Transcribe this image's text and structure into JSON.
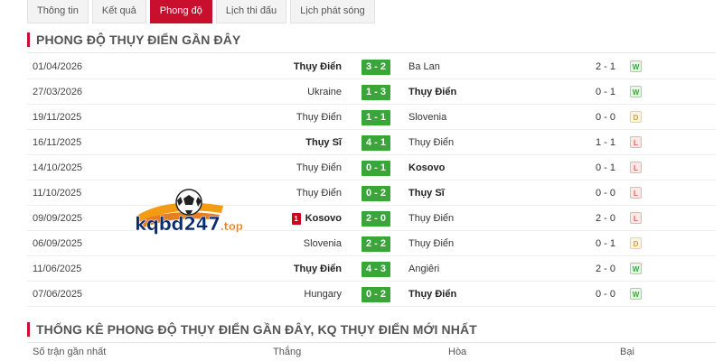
{
  "tabs": [
    {
      "label": "Thông tin",
      "active": false
    },
    {
      "label": "Kết quả",
      "active": false
    },
    {
      "label": "Phong độ",
      "active": true
    },
    {
      "label": "Lịch thi đấu",
      "active": false
    },
    {
      "label": "Lịch phát sóng",
      "active": false
    }
  ],
  "section1": {
    "title": "PHONG ĐỘ THỤY ĐIỂN GẦN ĐÂY"
  },
  "matches": [
    {
      "date": "01/04/2026",
      "home": "Thụy Điển",
      "home_bold": true,
      "score": "3 - 2",
      "away": "Ba Lan",
      "away_bold": false,
      "ht": "2 - 1",
      "result": "W",
      "red_card": ""
    },
    {
      "date": "27/03/2026",
      "home": "Ukraine",
      "home_bold": false,
      "score": "1 - 3",
      "away": "Thụy Điển",
      "away_bold": true,
      "ht": "0 - 1",
      "result": "W",
      "red_card": ""
    },
    {
      "date": "19/11/2025",
      "home": "Thụy Điển",
      "home_bold": false,
      "score": "1 - 1",
      "away": "Slovenia",
      "away_bold": false,
      "ht": "0 - 0",
      "result": "D",
      "red_card": ""
    },
    {
      "date": "16/11/2025",
      "home": "Thụy Sĩ",
      "home_bold": true,
      "score": "4 - 1",
      "away": "Thụy Điển",
      "away_bold": false,
      "ht": "1 - 1",
      "result": "L",
      "red_card": ""
    },
    {
      "date": "14/10/2025",
      "home": "Thụy Điển",
      "home_bold": false,
      "score": "0 - 1",
      "away": "Kosovo",
      "away_bold": true,
      "ht": "0 - 1",
      "result": "L",
      "red_card": ""
    },
    {
      "date": "11/10/2025",
      "home": "Thụy Điển",
      "home_bold": false,
      "score": "0 - 2",
      "away": "Thụy Sĩ",
      "away_bold": true,
      "ht": "0 - 0",
      "result": "L",
      "red_card": ""
    },
    {
      "date": "09/09/2025",
      "home": "Kosovo",
      "home_bold": true,
      "score": "2 - 0",
      "away": "Thụy Điển",
      "away_bold": false,
      "ht": "2 - 0",
      "result": "L",
      "red_card": "1"
    },
    {
      "date": "06/09/2025",
      "home": "Slovenia",
      "home_bold": false,
      "score": "2 - 2",
      "away": "Thụy Điển",
      "away_bold": false,
      "ht": "0 - 1",
      "result": "D",
      "red_card": ""
    },
    {
      "date": "11/06/2025",
      "home": "Thụy Điển",
      "home_bold": true,
      "score": "4 - 3",
      "away": "Angiêri",
      "away_bold": false,
      "ht": "2 - 0",
      "result": "W",
      "red_card": ""
    },
    {
      "date": "07/06/2025",
      "home": "Hungary",
      "home_bold": false,
      "score": "0 - 2",
      "away": "Thụy Điển",
      "away_bold": true,
      "ht": "0 - 0",
      "result": "W",
      "red_card": ""
    }
  ],
  "logo": {
    "text": "kqbd247",
    "suffix": ".top",
    "icon": "soccer-ball-icon"
  },
  "section2": {
    "title": "THỐNG KÊ PHONG ĐỘ THỤY ĐIỂN GẦN ĐÂY, KQ THỤY ĐIỂN MỚI NHẤT"
  },
  "stats_header": {
    "col1": "Số trận gần nhất",
    "col2": "Thắng",
    "col3": "Hòa",
    "col4": "Bại"
  },
  "colors": {
    "accent": "#c8102e",
    "score_bg": "#3aa63a",
    "win": "#3aa63a",
    "draw": "#e0a020",
    "loss": "#e06060"
  }
}
